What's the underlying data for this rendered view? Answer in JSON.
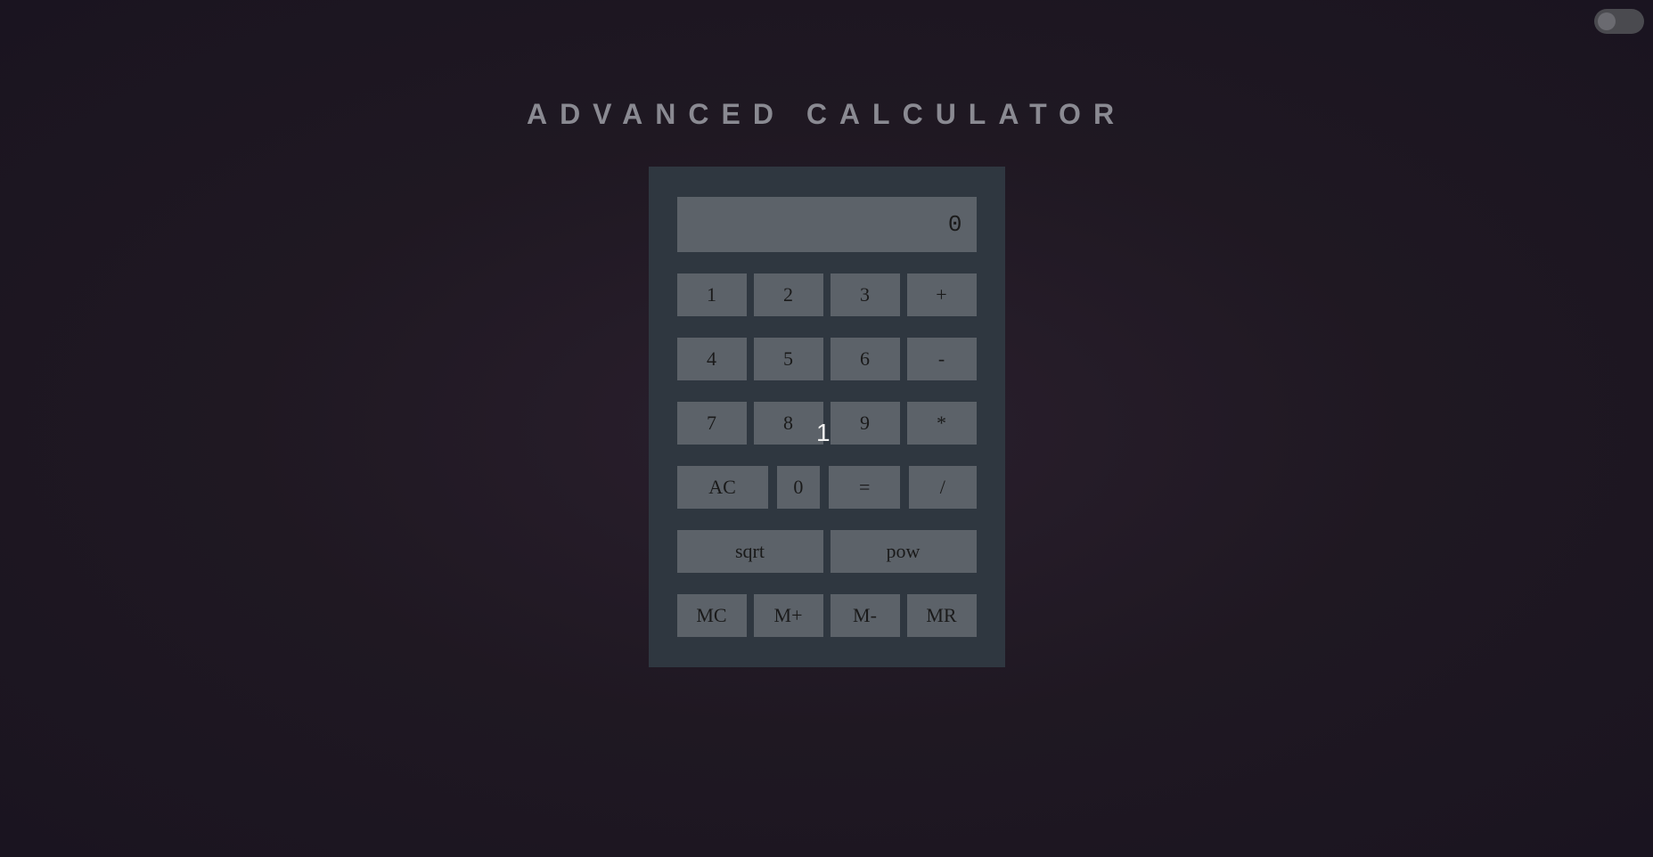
{
  "title": "ADVANCED CALCULATOR",
  "display": "0",
  "buttons": {
    "row1": [
      "1",
      "2",
      "3",
      "+"
    ],
    "row2": [
      "4",
      "5",
      "6",
      "-"
    ],
    "row3": [
      "7",
      "8",
      "9",
      "*"
    ],
    "row4": [
      "AC",
      "0",
      "=",
      "/"
    ],
    "row5": [
      "sqrt",
      "pow"
    ],
    "row6": [
      "MC",
      "M+",
      "M-",
      "MR"
    ]
  },
  "cursor_label": "1"
}
